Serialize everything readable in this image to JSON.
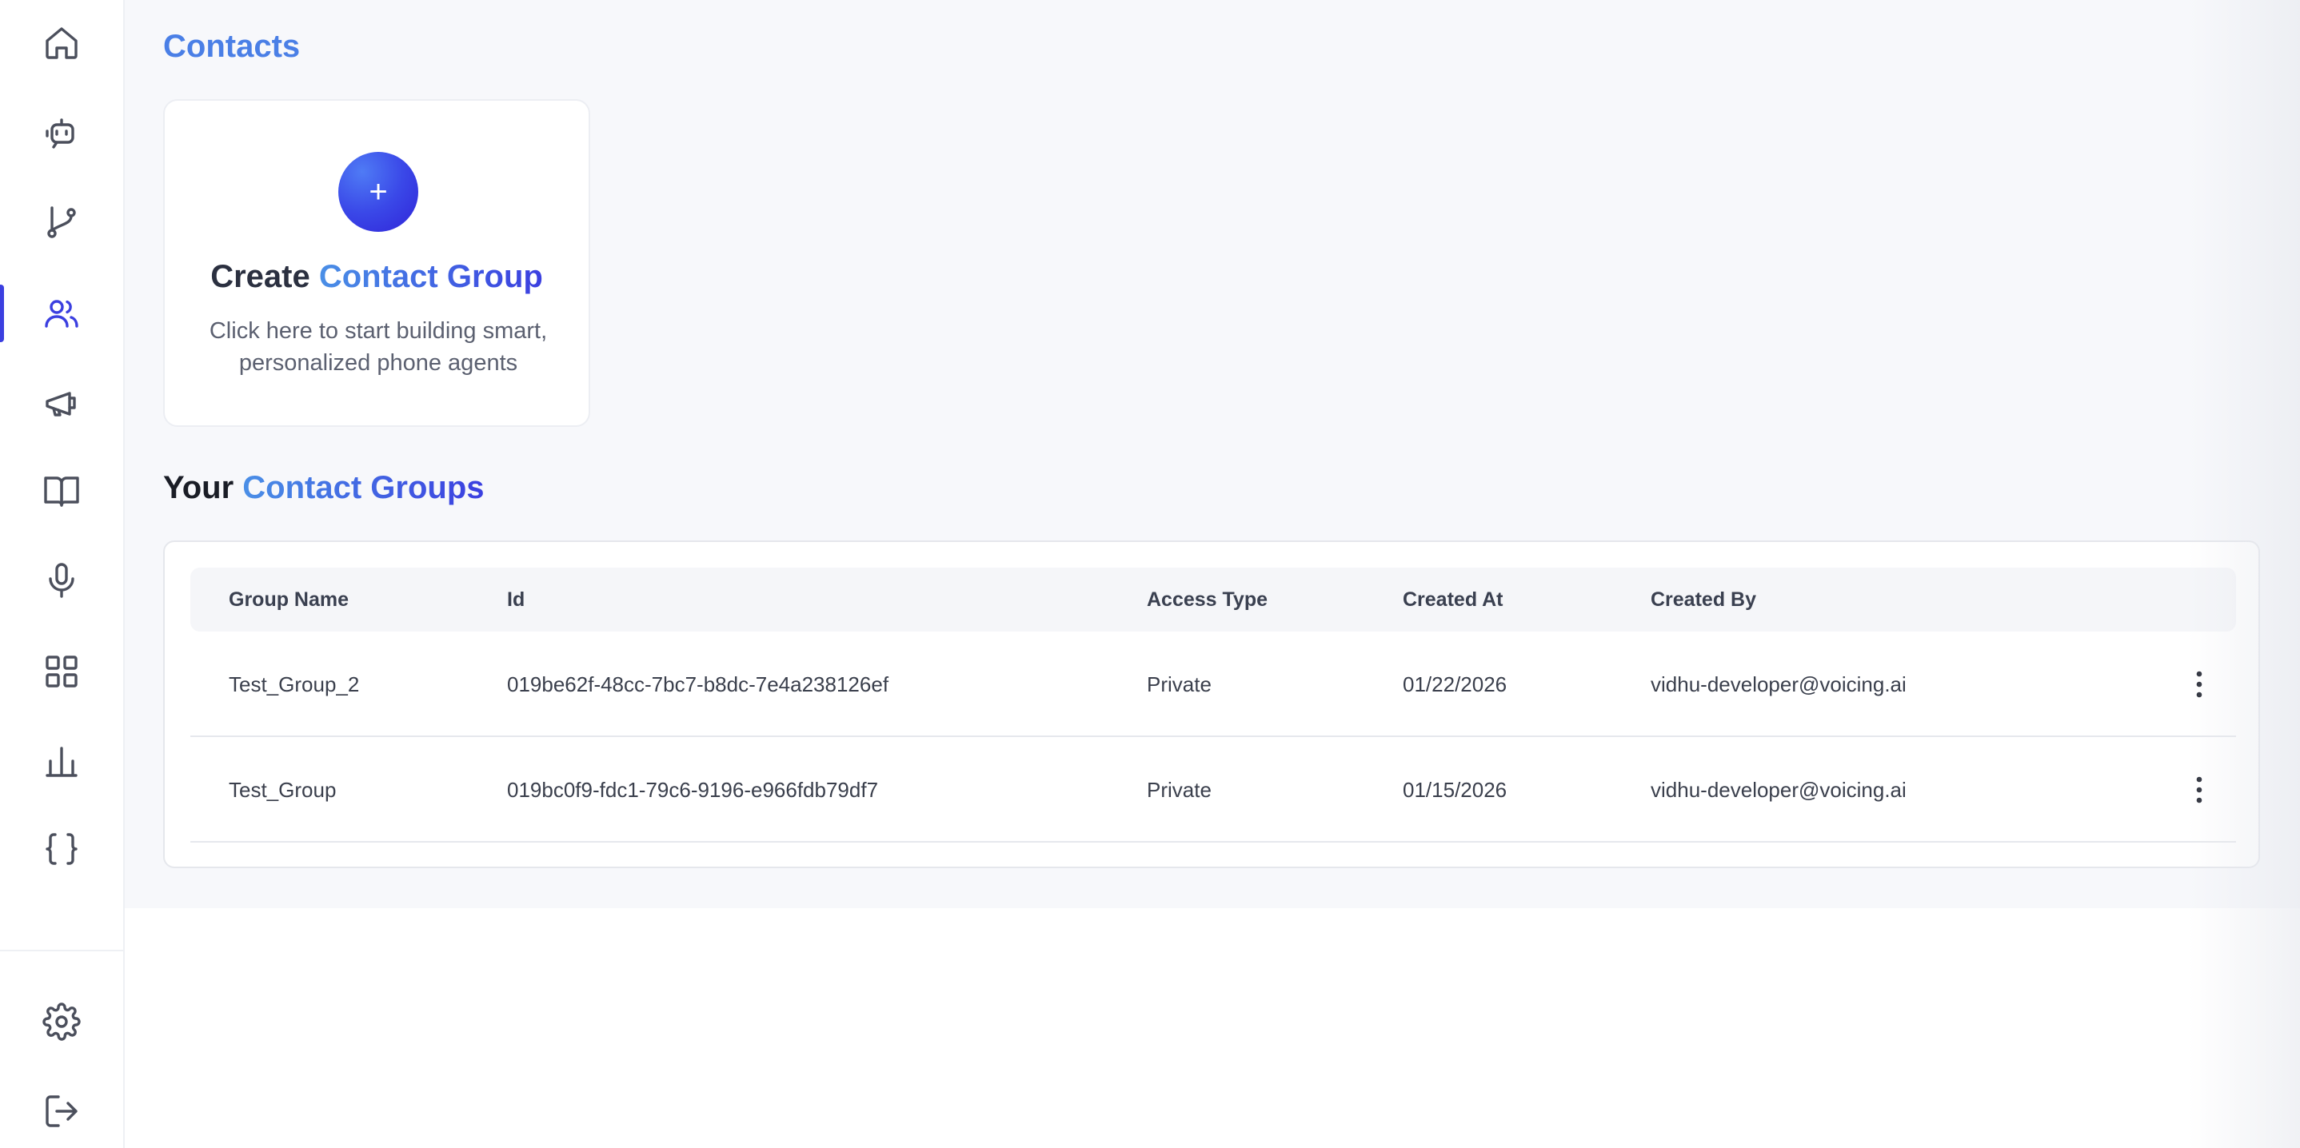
{
  "page": {
    "title": "Contacts"
  },
  "sidebar": {
    "items": [
      {
        "icon": "home-icon"
      },
      {
        "icon": "bot-icon"
      },
      {
        "icon": "git-branch-icon"
      },
      {
        "icon": "users-icon",
        "active": true
      },
      {
        "icon": "megaphone-icon"
      },
      {
        "icon": "book-open-icon"
      },
      {
        "icon": "microphone-icon"
      },
      {
        "icon": "grid-icon"
      },
      {
        "icon": "bar-chart-icon"
      },
      {
        "icon": "braces-icon"
      }
    ],
    "bottom": [
      {
        "icon": "gear-icon"
      },
      {
        "icon": "logout-icon"
      }
    ]
  },
  "create_card": {
    "plus": "+",
    "title_prefix": "Create",
    "title_highlight": "Contact Group",
    "description": "Click here to start building smart, personalized phone agents"
  },
  "groups_section": {
    "title_prefix": "Your",
    "title_highlight": "Contact Groups"
  },
  "table": {
    "headers": [
      "Group Name",
      "Id",
      "Access Type",
      "Created At",
      "Created By"
    ],
    "rows": [
      {
        "name": "Test_Group_2",
        "id": "019be62f-48cc-7bc7-b8dc-7e4a238126ef",
        "access": "Private",
        "created_at": "01/22/2026",
        "created_by": "vidhu-developer@voicing.ai"
      },
      {
        "name": "Test_Group",
        "id": "019bc0f9-fdc1-79c6-9196-e966fdb79df7",
        "access": "Private",
        "created_at": "01/15/2026",
        "created_by": "vidhu-developer@voicing.ai"
      }
    ]
  },
  "colors": {
    "accent": "#3b3fe0",
    "title_blue": "#4a7fe6"
  }
}
